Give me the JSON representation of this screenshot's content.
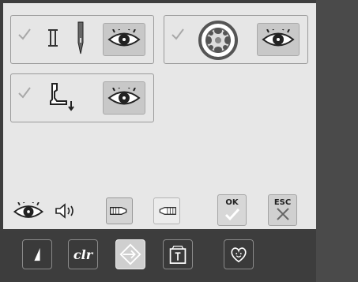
{
  "options": [
    {
      "id": "needle",
      "checked": true
    },
    {
      "id": "bobbin",
      "checked": true
    },
    {
      "id": "presser-foot",
      "checked": true
    }
  ],
  "bottom_toolbar": {
    "ok_label": "OK",
    "esc_label": "ESC"
  },
  "navbar": {
    "clr_label": "clr"
  },
  "sidebar": {
    "alphabet_label": "A"
  },
  "colors": {
    "background": "#e7e7e7",
    "card_border": "#9a9a9a",
    "eye_button": "#c8c8c8",
    "side_button": "#f0f0f0",
    "dark_panel": "#3d3d3d",
    "ok_button": "#d7d7d7",
    "esc_button": "#d0d0d0"
  }
}
